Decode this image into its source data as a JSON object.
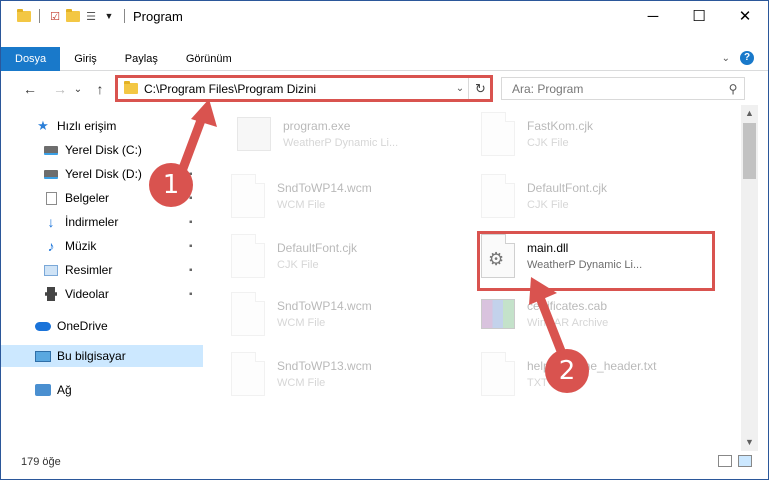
{
  "window": {
    "title": "Program",
    "controls": {
      "minimize": "─",
      "maximize": "☐",
      "close": "✕"
    }
  },
  "ribbon": {
    "tabs": [
      {
        "label": "Dosya",
        "active": true
      },
      {
        "label": "Giriş"
      },
      {
        "label": "Paylaş"
      },
      {
        "label": "Görünüm"
      }
    ],
    "help": "?"
  },
  "nav": {
    "back": "←",
    "forward": "→",
    "recent": "⌄",
    "up": "↑",
    "address": "C:\\Program Files\\Program Dizini",
    "dropdown": "⌄",
    "refresh": "↻",
    "search_placeholder": "Ara: Program",
    "search_icon": "⚲"
  },
  "sidebar": {
    "items": [
      {
        "label": "Hızlı erişim",
        "icon": "star-icon"
      },
      {
        "label": "Yerel Disk (C:)",
        "icon": "disk-icon",
        "pinned": true
      },
      {
        "label": "Yerel Disk (D:)",
        "icon": "disk-icon",
        "pinned": true
      },
      {
        "label": "Belgeler",
        "icon": "document-icon",
        "pinned": true
      },
      {
        "label": "İndirmeler",
        "icon": "download-icon",
        "pinned": true
      },
      {
        "label": "Müzik",
        "icon": "music-icon",
        "pinned": true
      },
      {
        "label": "Resimler",
        "icon": "pictures-icon",
        "pinned": true
      },
      {
        "label": "Videolar",
        "icon": "videos-icon",
        "pinned": true
      },
      {
        "label": "OneDrive",
        "icon": "cloud-icon"
      },
      {
        "label": "Bu bilgisayar",
        "icon": "computer-icon",
        "selected": true
      },
      {
        "label": "Ağ",
        "icon": "network-icon"
      }
    ],
    "pin_glyph": "📌"
  },
  "files": [
    {
      "name": "program.exe",
      "type": "WeatherP Dynamic Li...",
      "faded": true,
      "icon": "exe-icon"
    },
    {
      "name": "FastKom.cjk",
      "type": "CJK File",
      "faded": true,
      "icon": "blank-file-icon"
    },
    {
      "name": "SndToWP14.wcm",
      "type": "WCM File",
      "faded": true,
      "icon": "blank-file-icon"
    },
    {
      "name": "DefaultFont.cjk",
      "type": "CJK File",
      "faded": true,
      "icon": "blank-file-icon"
    },
    {
      "name": "DefaultFont.cjk",
      "type": "CJK File",
      "faded": true,
      "icon": "blank-file-icon"
    },
    {
      "name": "main.dll",
      "type": "WeatherP Dynamic Li...",
      "faded": false,
      "icon": "dll-gear-icon"
    },
    {
      "name": "SndToWP14.wcm",
      "type": "WCM File",
      "faded": true,
      "icon": "blank-file-icon"
    },
    {
      "name": "certificates.cab",
      "type": "WinRAR Archive",
      "faded": true,
      "icon": "winrar-icon"
    },
    {
      "name": "SndToWP13.wcm",
      "type": "WCM File",
      "faded": true,
      "icon": "blank-file-icon"
    },
    {
      "name": "help_readme_header.txt",
      "type": "TXT File",
      "faded": true,
      "icon": "blank-file-icon"
    }
  ],
  "status": {
    "count": "179 öğe"
  },
  "callouts": {
    "one": "1",
    "two": "2"
  },
  "colors": {
    "accent": "#1979ca",
    "highlight": "#d9534f",
    "selected": "#cce8ff"
  }
}
